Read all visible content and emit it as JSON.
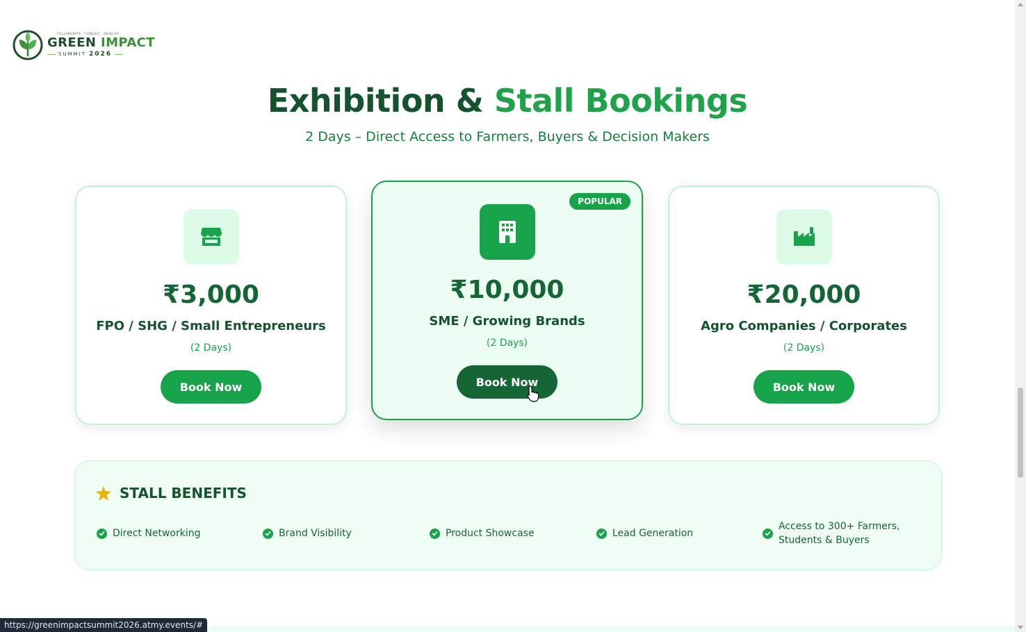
{
  "logo": {
    "tagline": "COLLABORATE · CONSULT · DEVELOP",
    "name_part1": "GREEN",
    "name_part2": "IMPACT",
    "sub_word": "SUMMIT",
    "year": "2026"
  },
  "section": {
    "title_part1": "Exhibition &",
    "title_part2": "Stall Bookings",
    "subtitle": "2 Days – Direct Access to Farmers, Buyers & Decision Makers"
  },
  "cards": [
    {
      "icon": "store-icon",
      "price": "₹3,000",
      "tier": "FPO / SHG / Small Entrepreneurs",
      "duration": "(2 Days)",
      "button": "Book Now"
    },
    {
      "icon": "building-icon",
      "price": "₹10,000",
      "tier": "SME / Growing Brands",
      "duration": "(2 Days)",
      "button": "Book Now",
      "badge": "POPULAR"
    },
    {
      "icon": "factory-icon",
      "price": "₹20,000",
      "tier": "Agro Companies / Corporates",
      "duration": "(2 Days)",
      "button": "Book Now"
    }
  ],
  "benefits": {
    "title": "STALL BENEFITS",
    "items": [
      "Direct Networking",
      "Brand Visibility",
      "Product Showcase",
      "Lead Generation",
      "Access to 300+ Farmers, Students & Buyers"
    ]
  },
  "status_url": "https://greenimpactsummit2026.atmy.events/#",
  "colors": {
    "primary": "#16a34a",
    "dark_green": "#14532d",
    "light_green": "#dcfce7",
    "popular_bg": "#ecfdf3"
  }
}
